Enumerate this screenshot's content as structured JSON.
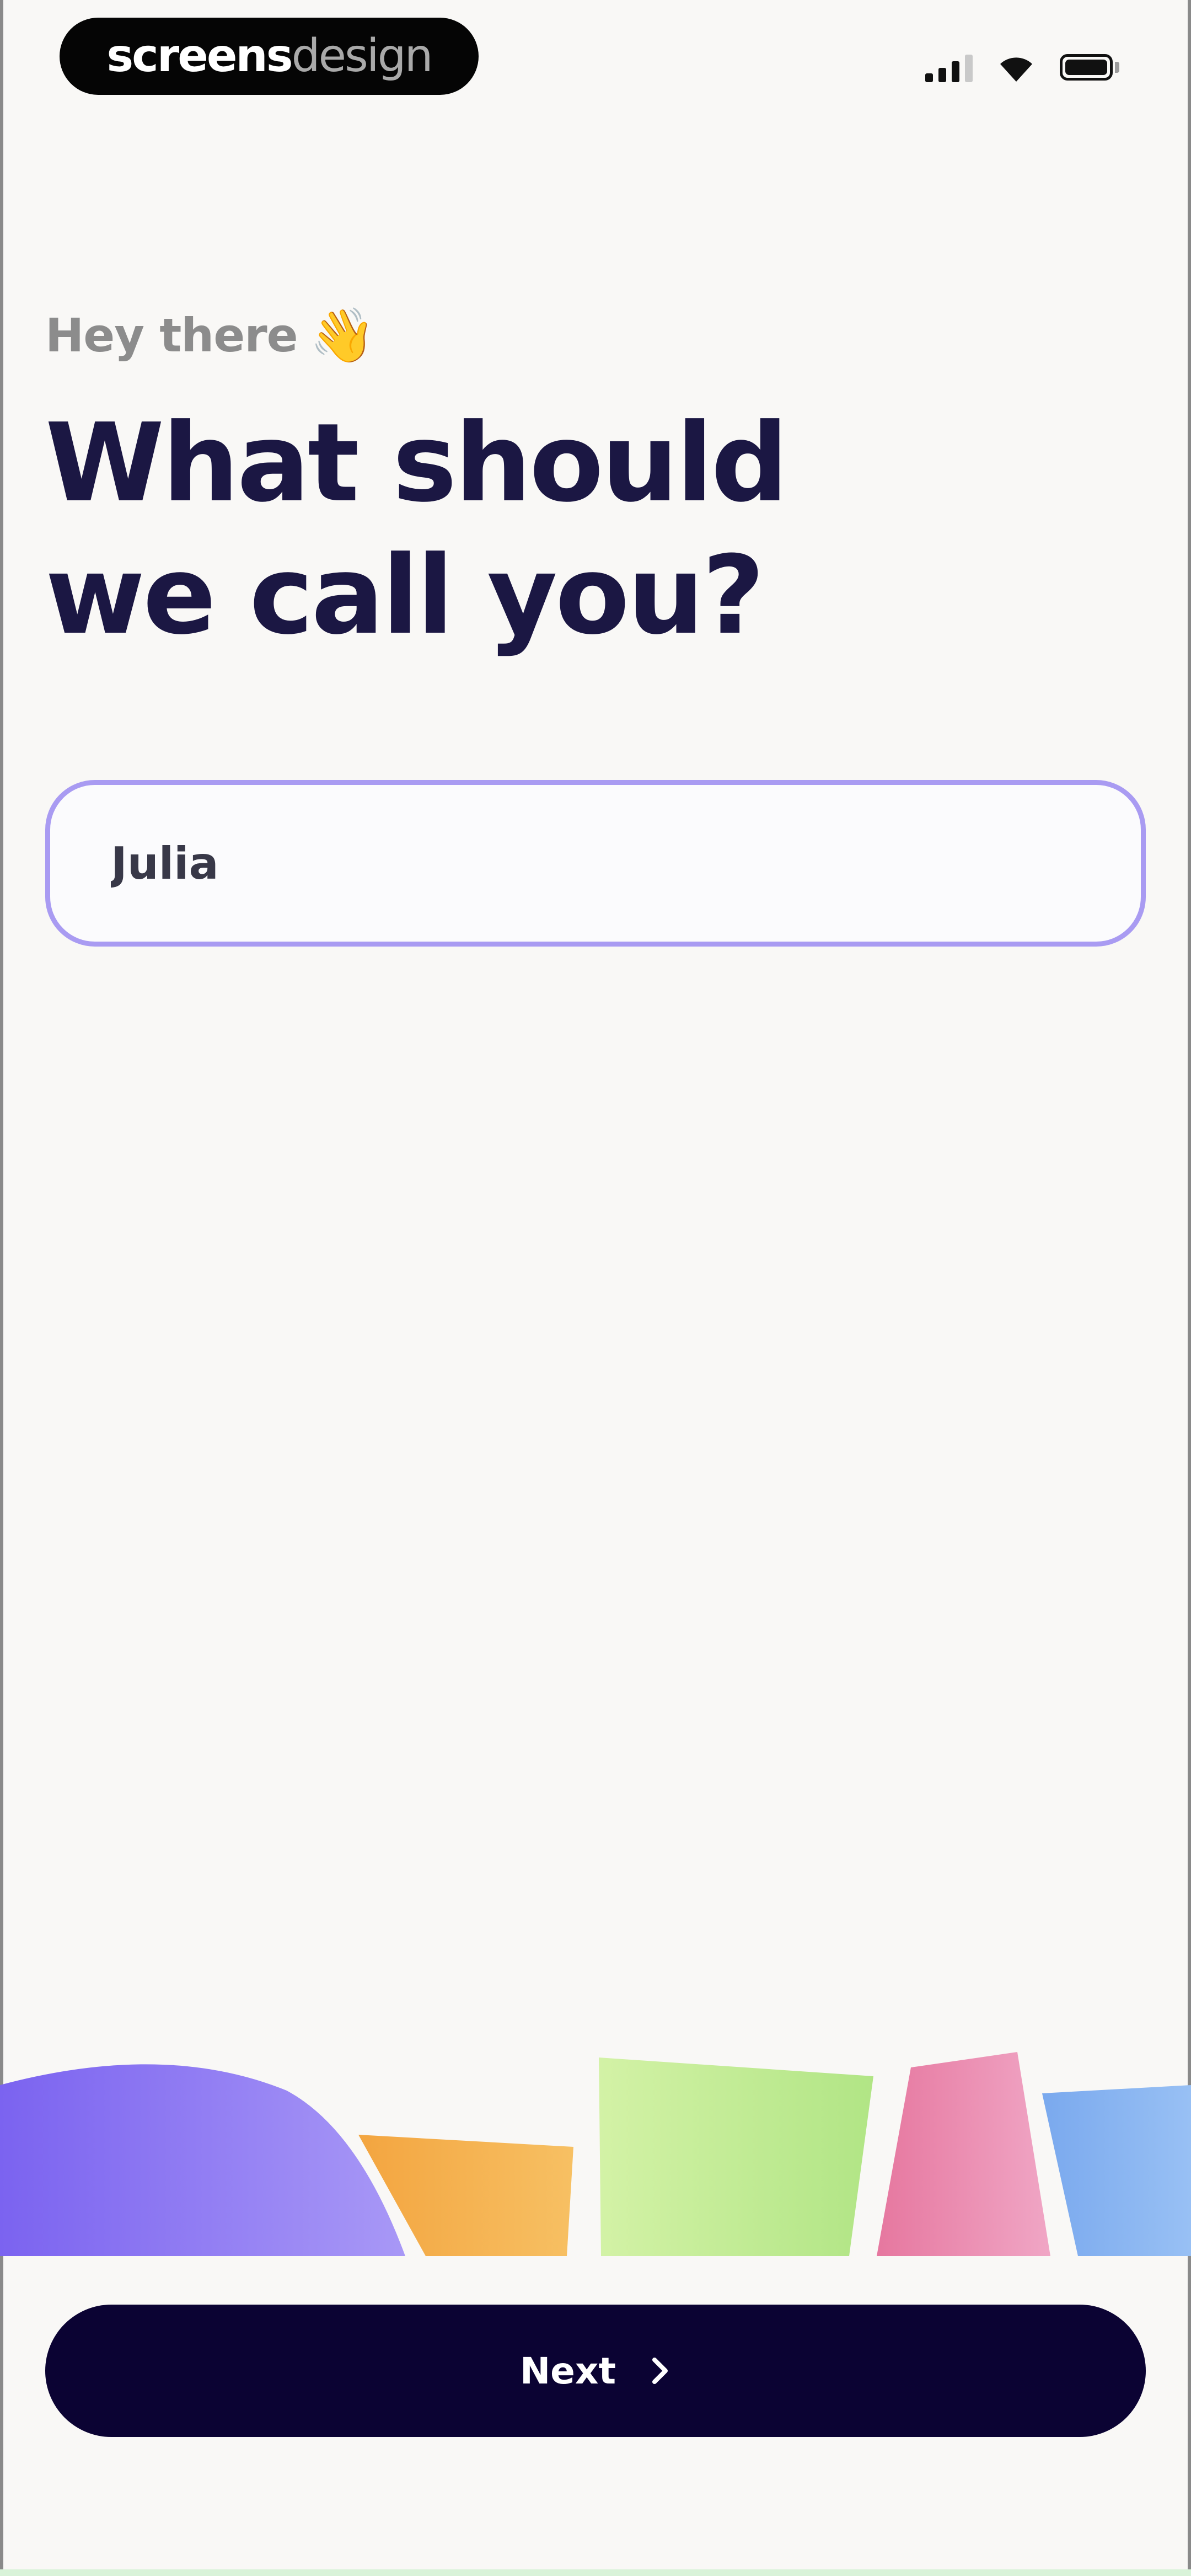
{
  "status_bar": {
    "brand_bold": "screens",
    "brand_light": "design"
  },
  "header": {
    "greeting": "Hey there",
    "greeting_icon": "waving-hand-icon",
    "title_line_1": "What should",
    "title_line_2": "we call you?"
  },
  "name_field": {
    "value": "Julia"
  },
  "next_button": {
    "label": "Next",
    "icon": "chevron-right-icon"
  },
  "colors": {
    "background": "#f9f8f6",
    "title": "#1b1743",
    "greeting": "#8c8c8c",
    "input_border": "#a99bf2",
    "button": "#0b0333",
    "shape_purple": "#8b74f3",
    "shape_orange": "#f5ad4c",
    "shape_green": "#b8ea8c",
    "shape_pink": "#ec8db4",
    "shape_blue": "#84b3f0"
  }
}
